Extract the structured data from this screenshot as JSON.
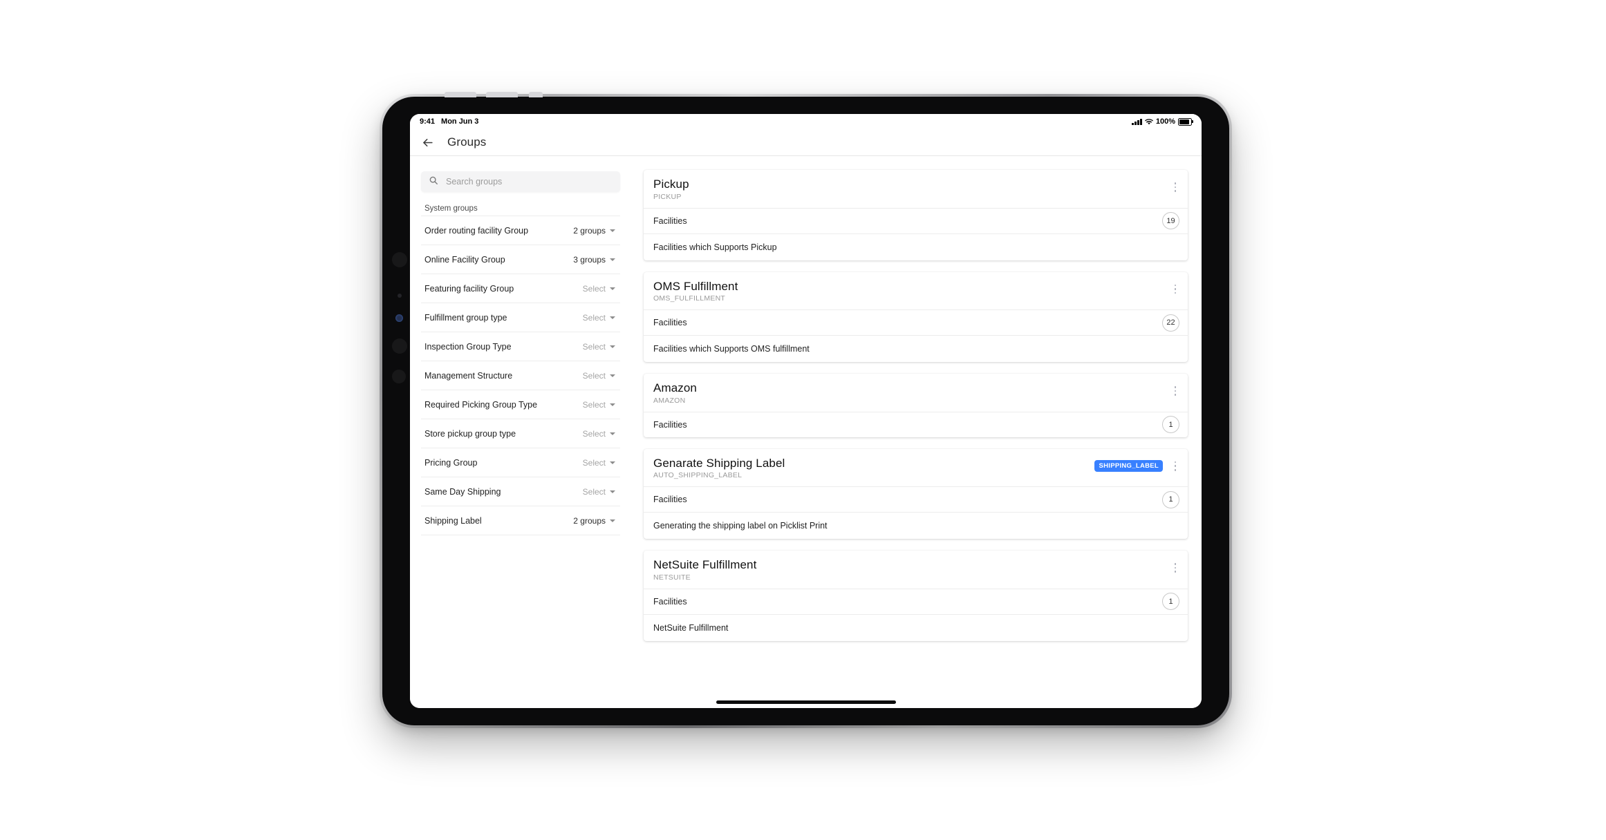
{
  "statusbar": {
    "time": "9:41",
    "date": "Mon Jun 3",
    "battery_percent": "100%",
    "icons": {
      "signal": "signal-bars-icon",
      "wifi": "wifi-icon",
      "battery": "battery-icon"
    }
  },
  "toolbar": {
    "back_icon": "back-arrow-icon",
    "title": "Groups"
  },
  "search": {
    "placeholder": "Search groups",
    "value": "",
    "icon": "search-icon"
  },
  "sidebar": {
    "section_label": "System groups",
    "items": [
      {
        "label": "Order routing facility Group",
        "value": "2 groups",
        "muted": false
      },
      {
        "label": "Online Facility Group",
        "value": "3 groups",
        "muted": false
      },
      {
        "label": "Featuring facility Group",
        "value": "Select",
        "muted": true
      },
      {
        "label": "Fulfillment group type",
        "value": "Select",
        "muted": true
      },
      {
        "label": "Inspection Group Type",
        "value": "Select",
        "muted": true
      },
      {
        "label": "Management Structure",
        "value": "Select",
        "muted": true
      },
      {
        "label": "Required Picking Group Type",
        "value": "Select",
        "muted": true
      },
      {
        "label": "Store pickup group type",
        "value": "Select",
        "muted": true
      },
      {
        "label": "Pricing Group",
        "value": "Select",
        "muted": true
      },
      {
        "label": "Same Day Shipping",
        "value": "Select",
        "muted": true
      },
      {
        "label": "Shipping Label",
        "value": "2 groups",
        "muted": false
      }
    ]
  },
  "cards": [
    {
      "title": "Pickup",
      "code": "PICKUP",
      "badge": "",
      "facilities_label": "Facilities",
      "facilities_count": "19",
      "description": "Facilities which Supports Pickup"
    },
    {
      "title": "OMS Fulfillment",
      "code": "OMS_FULFILLMENT",
      "badge": "",
      "facilities_label": "Facilities",
      "facilities_count": "22",
      "description": "Facilities which Supports OMS fulfillment"
    },
    {
      "title": "Amazon",
      "code": "AMAZON",
      "badge": "",
      "facilities_label": "Facilities",
      "facilities_count": "1",
      "description": ""
    },
    {
      "title": "Genarate Shipping Label",
      "code": "AUTO_SHIPPING_LABEL",
      "badge": "SHIPPING_LABEL",
      "facilities_label": "Facilities",
      "facilities_count": "1",
      "description": "Generating the shipping label on Picklist Print"
    },
    {
      "title": "NetSuite Fulfillment",
      "code": "NETSUITE",
      "badge": "",
      "facilities_label": "Facilities",
      "facilities_count": "1",
      "description": "NetSuite Fulfillment"
    }
  ],
  "colors": {
    "badge_blue": "#3880ff",
    "muted_text": "#a4a4a4",
    "divider": "#ececec"
  }
}
